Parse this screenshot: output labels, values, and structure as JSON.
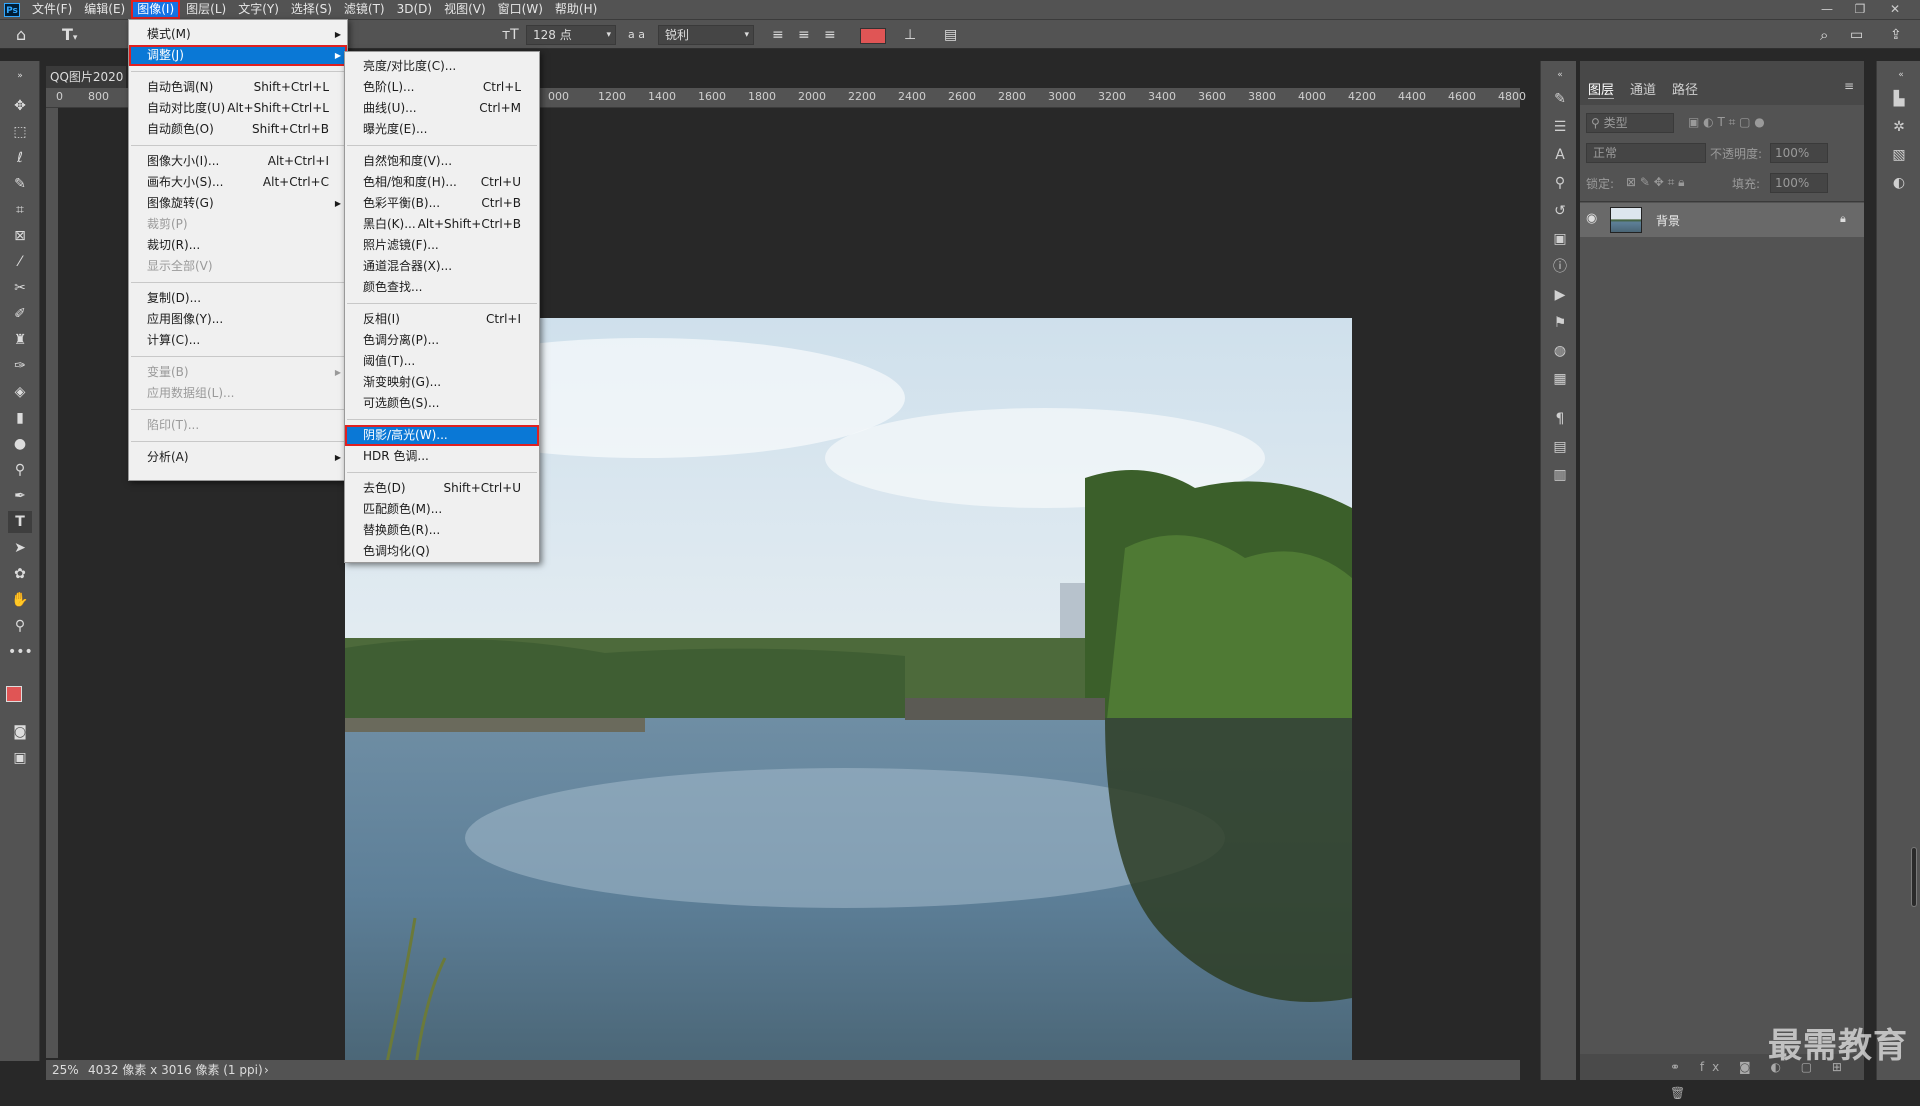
{
  "menubar": {
    "app_icon": "Ps",
    "items": [
      "文件(F)",
      "编辑(E)",
      "图像(I)",
      "图层(L)",
      "文字(Y)",
      "选择(S)",
      "滤镜(T)",
      "3D(D)",
      "视图(V)",
      "窗口(W)",
      "帮助(H)"
    ],
    "active_index": 2
  },
  "window_controls": {
    "minimize": "—",
    "restore": "❐",
    "close": "✕"
  },
  "options_bar": {
    "font_size": "128 点",
    "aa_label": "a a",
    "aa_mode": "锐利",
    "text_color": "#e05555"
  },
  "document": {
    "tab_title": "QQ图片2020",
    "zoom": "25%",
    "info": "4032 像素 x 3016 像素 (1 ppi)"
  },
  "ruler": {
    "left_ticks": [
      "0",
      "800"
    ],
    "right_ticks": [
      "000",
      "1200",
      "1400",
      "1600",
      "1800",
      "2000",
      "2200",
      "2400",
      "2600",
      "2800",
      "3000",
      "3200",
      "3400",
      "3600",
      "3800",
      "4000",
      "4200",
      "4400",
      "4600",
      "4800"
    ]
  },
  "image_menu": {
    "items": [
      {
        "label": "模式(M)",
        "shortcut": "",
        "submenu": true,
        "disabled": false
      },
      {
        "label": "调整(J)",
        "shortcut": "",
        "submenu": true,
        "disabled": false,
        "highlight": true
      },
      {
        "label": "自动色调(N)",
        "shortcut": "Shift+Ctrl+L",
        "submenu": false,
        "disabled": false
      },
      {
        "label": "自动对比度(U)",
        "shortcut": "Alt+Shift+Ctrl+L",
        "submenu": false,
        "disabled": false
      },
      {
        "label": "自动颜色(O)",
        "shortcut": "Shift+Ctrl+B",
        "submenu": false,
        "disabled": false
      },
      {
        "label": "图像大小(I)...",
        "shortcut": "Alt+Ctrl+I",
        "submenu": false,
        "disabled": false
      },
      {
        "label": "画布大小(S)...",
        "shortcut": "Alt+Ctrl+C",
        "submenu": false,
        "disabled": false
      },
      {
        "label": "图像旋转(G)",
        "shortcut": "",
        "submenu": true,
        "disabled": false
      },
      {
        "label": "裁剪(P)",
        "shortcut": "",
        "submenu": false,
        "disabled": true
      },
      {
        "label": "裁切(R)...",
        "shortcut": "",
        "submenu": false,
        "disabled": false
      },
      {
        "label": "显示全部(V)",
        "shortcut": "",
        "submenu": false,
        "disabled": true
      },
      {
        "label": "复制(D)...",
        "shortcut": "",
        "submenu": false,
        "disabled": false
      },
      {
        "label": "应用图像(Y)...",
        "shortcut": "",
        "submenu": false,
        "disabled": false
      },
      {
        "label": "计算(C)...",
        "shortcut": "",
        "submenu": false,
        "disabled": false
      },
      {
        "label": "变量(B)",
        "shortcut": "",
        "submenu": true,
        "disabled": true
      },
      {
        "label": "应用数据组(L)...",
        "shortcut": "",
        "submenu": false,
        "disabled": true
      },
      {
        "label": "陷印(T)...",
        "shortcut": "",
        "submenu": false,
        "disabled": true
      },
      {
        "label": "分析(A)",
        "shortcut": "",
        "submenu": true,
        "disabled": false
      }
    ]
  },
  "adjust_menu": {
    "items": [
      {
        "label": "亮度/对比度(C)...",
        "shortcut": ""
      },
      {
        "label": "色阶(L)...",
        "shortcut": "Ctrl+L"
      },
      {
        "label": "曲线(U)...",
        "shortcut": "Ctrl+M"
      },
      {
        "label": "曝光度(E)...",
        "shortcut": ""
      },
      {
        "label": "自然饱和度(V)...",
        "shortcut": ""
      },
      {
        "label": "色相/饱和度(H)...",
        "shortcut": "Ctrl+U"
      },
      {
        "label": "色彩平衡(B)...",
        "shortcut": "Ctrl+B"
      },
      {
        "label": "黑白(K)...",
        "shortcut": "Alt+Shift+Ctrl+B"
      },
      {
        "label": "照片滤镜(F)...",
        "shortcut": ""
      },
      {
        "label": "通道混合器(X)...",
        "shortcut": ""
      },
      {
        "label": "颜色查找...",
        "shortcut": ""
      },
      {
        "label": "反相(I)",
        "shortcut": "Ctrl+I"
      },
      {
        "label": "色调分离(P)...",
        "shortcut": ""
      },
      {
        "label": "阈值(T)...",
        "shortcut": ""
      },
      {
        "label": "渐变映射(G)...",
        "shortcut": ""
      },
      {
        "label": "可选颜色(S)...",
        "shortcut": ""
      },
      {
        "label": "阴影/高光(W)...",
        "shortcut": "",
        "highlight": true
      },
      {
        "label": "HDR 色调...",
        "shortcut": ""
      },
      {
        "label": "去色(D)",
        "shortcut": "Shift+Ctrl+U"
      },
      {
        "label": "匹配颜色(M)...",
        "shortcut": ""
      },
      {
        "label": "替换颜色(R)...",
        "shortcut": ""
      },
      {
        "label": "色调均化(Q)",
        "shortcut": ""
      }
    ]
  },
  "layers_panel": {
    "tabs": [
      "图层",
      "通道",
      "路径"
    ],
    "filter_placeholder": "类型",
    "blend_mode": "正常",
    "opacity_label": "不透明度:",
    "opacity_value": "100%",
    "lock_label": "锁定:",
    "fill_label": "填充:",
    "fill_value": "100%",
    "layers": [
      {
        "name": "背景",
        "visible": true,
        "locked": true
      }
    ]
  },
  "watermark": "最需教育"
}
